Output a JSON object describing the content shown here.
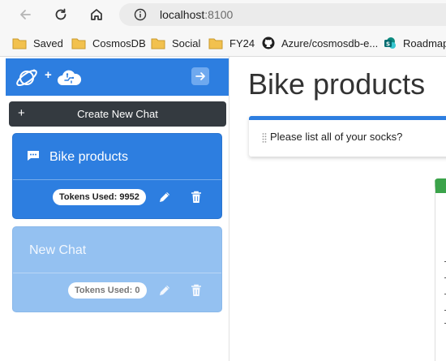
{
  "browser": {
    "url_host": "localhost",
    "url_port": ":8100",
    "bookmarks": [
      {
        "label": "Saved",
        "icon": "folder-icon"
      },
      {
        "label": "CosmosDB",
        "icon": "folder-icon"
      },
      {
        "label": "Social",
        "icon": "folder-icon"
      },
      {
        "label": "FY24",
        "icon": "folder-icon"
      },
      {
        "label": "Azure/cosmosdb-e...",
        "icon": "github-icon"
      },
      {
        "label": "Roadmap",
        "icon": "sharepoint-icon"
      }
    ]
  },
  "sidebar": {
    "header_plus": "+",
    "new_chat_label": "Create New Chat",
    "new_chat_plus": "+",
    "chats": [
      {
        "title": "Bike products",
        "tokens": "Tokens Used: 9952",
        "active": true
      },
      {
        "title": "New Chat",
        "tokens": "Tokens Used: 0",
        "active": false
      }
    ]
  },
  "main": {
    "title": "Bike products",
    "prompt": "Please list all of your socks?"
  },
  "colors": {
    "accent": "#2d7ee0",
    "inactive_card": "#94c1f1",
    "dark_button": "#343a40",
    "response_header": "#3ba34a"
  }
}
